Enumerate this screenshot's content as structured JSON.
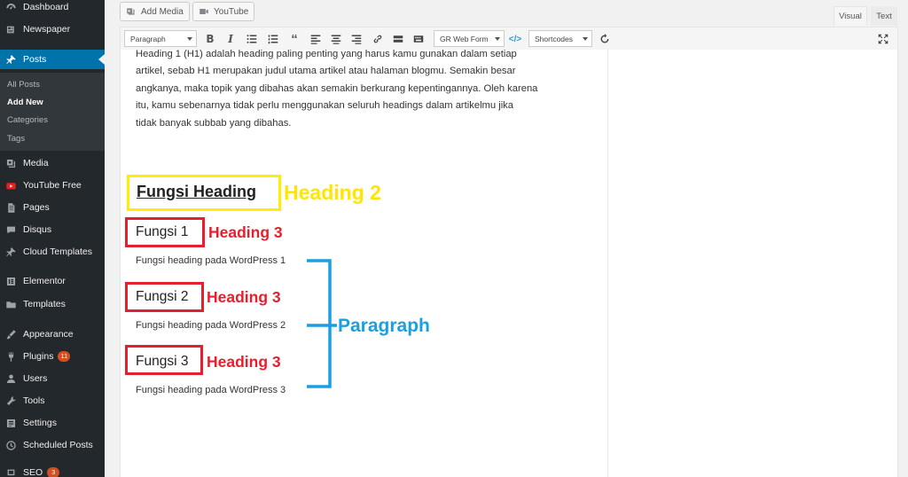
{
  "sidebar": {
    "items": [
      {
        "label": "Dashboard",
        "icon": "dashboard-icon"
      },
      {
        "label": "Newspaper",
        "icon": "newspaper-icon"
      },
      {
        "label": "Posts",
        "icon": "pushpin-icon"
      },
      {
        "label": "Media",
        "icon": "media-icon"
      },
      {
        "label": "YouTube Free",
        "icon": "youtube-icon"
      },
      {
        "label": "Pages",
        "icon": "pages-icon"
      },
      {
        "label": "Disqus",
        "icon": "disqus-icon"
      },
      {
        "label": "Cloud Templates",
        "icon": "pushpin-icon"
      },
      {
        "label": "Elementor",
        "icon": "elementor-icon"
      },
      {
        "label": "Templates",
        "icon": "folder-icon"
      },
      {
        "label": "Appearance",
        "icon": "brush-icon"
      },
      {
        "label": "Plugins",
        "icon": "plugin-icon",
        "badge": "11"
      },
      {
        "label": "Users",
        "icon": "users-icon"
      },
      {
        "label": "Tools",
        "icon": "tools-icon"
      },
      {
        "label": "Settings",
        "icon": "settings-icon"
      },
      {
        "label": "Scheduled Posts",
        "icon": "clock-icon"
      },
      {
        "label": "SEO",
        "icon": "seo-icon",
        "badge": "3"
      }
    ],
    "submenu": [
      "All Posts",
      "Add New",
      "Categories",
      "Tags"
    ]
  },
  "media_buttons": {
    "add_media": "Add Media",
    "youtube": "YouTube"
  },
  "editor_tabs": {
    "visual": "Visual",
    "text": "Text"
  },
  "toolbar": {
    "format_select": "Paragraph",
    "gr_web_form": "GR Web Form",
    "shortcodes": "Shortcodes"
  },
  "content": {
    "paragraph_lines": [
      "Heading 1 (H1) adalah heading paling penting yang harus kamu gunakan dalam setiap",
      "artikel, sebab H1 merupakan judul utama artikel atau halaman blogmu. Semakin besar",
      "angkanya, maka topik yang dibahas akan semakin berkurang kepentingannya. Oleh karena",
      "itu, kamu sebenarnya tidak perlu menggunakan seluruh headings dalam artikelmu jika",
      "tidak banyak subbab yang dibahas."
    ],
    "heading2": "Fungsi Heading",
    "sections": [
      {
        "heading": "Fungsi 1",
        "text": "Fungsi heading pada WordPress 1"
      },
      {
        "heading": "Fungsi 2",
        "text": "Fungsi heading pada WordPress 2"
      },
      {
        "heading": "Fungsi 3",
        "text": "Fungsi heading pada WordPress 3"
      }
    ]
  },
  "annotations": {
    "heading2": "Heading 2",
    "heading3": "Heading 3",
    "paragraph": "Paragraph"
  },
  "colors": {
    "sidebar_bg": "#23282d",
    "active_blue": "#0073aa",
    "annotation_yellow": "#ffee00",
    "annotation_red": "#e5202e",
    "annotation_blue": "#1a9fe0"
  }
}
